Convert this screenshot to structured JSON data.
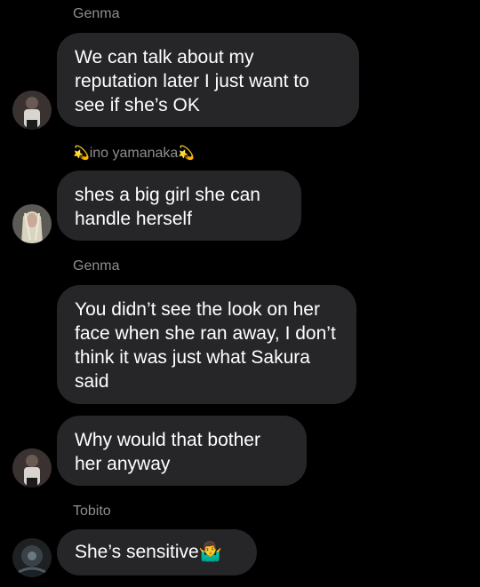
{
  "messages": [
    {
      "sender": "Genma",
      "text": "We can talk about my reputation later I just want to see if she’s OK"
    },
    {
      "sender": "ino yamanaka",
      "sender_prefix_emoji": "💫",
      "sender_suffix_emoji": "💫",
      "text": "shes a big girl she can handle herself"
    },
    {
      "sender": "Genma",
      "text": "You didn’t see the look on her face when she ran away, I don’t think it was just what Sakura said"
    },
    {
      "text": "Why would that bother her anyway"
    },
    {
      "sender": "Tobito",
      "text": "She’s sensitive🤷‍♂️"
    }
  ],
  "avatars": [
    {
      "name": "genma-avatar",
      "color": "#5a4a44"
    },
    {
      "name": "ino-avatar",
      "color": "#c9c5b8"
    },
    {
      "name": "genma-avatar",
      "color": "#5a4a44"
    },
    {
      "name": "tobito-avatar",
      "color": "#2c3236"
    }
  ]
}
